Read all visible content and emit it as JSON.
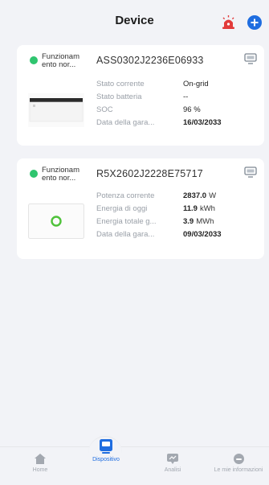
{
  "header": {
    "title": "Device",
    "alarm_icon": "alarm-siren-icon",
    "add_icon": "add-circle-icon",
    "accent": "#1f6de0",
    "alarm_color": "#e23b3b"
  },
  "devices": [
    {
      "status": "Funzionam ento nor...",
      "name": "ASS0302J2236E06933",
      "rows": [
        {
          "label": "Stato corrente",
          "value": "On-grid",
          "unit": ""
        },
        {
          "label": "Stato batteria",
          "value": "--",
          "unit": ""
        },
        {
          "label": "SOC",
          "value": "96 %",
          "unit": ""
        },
        {
          "label": "Data della gara...",
          "value": "16/03/2033",
          "unit": ""
        }
      ]
    },
    {
      "status": "Funzionam ento nor...",
      "name": "R5X2602J2228E75717",
      "rows": [
        {
          "label": "Potenza corrente",
          "value": "2837.0",
          "unit": "W"
        },
        {
          "label": "Energia di oggi",
          "value": "11.9",
          "unit": "kWh"
        },
        {
          "label": "Energia totale g...",
          "value": "3.9",
          "unit": "MWh"
        },
        {
          "label": "Data della gara...",
          "value": "09/03/2033",
          "unit": ""
        }
      ]
    }
  ],
  "tabs": [
    {
      "label": "Home",
      "icon": "home-icon"
    },
    {
      "label": "Dispositivo",
      "icon": "device-icon"
    },
    {
      "label": "Analisi",
      "icon": "analysis-icon"
    },
    {
      "label": "Le mie informazioni",
      "icon": "profile-icon"
    }
  ],
  "status_color": "#2fc56f"
}
